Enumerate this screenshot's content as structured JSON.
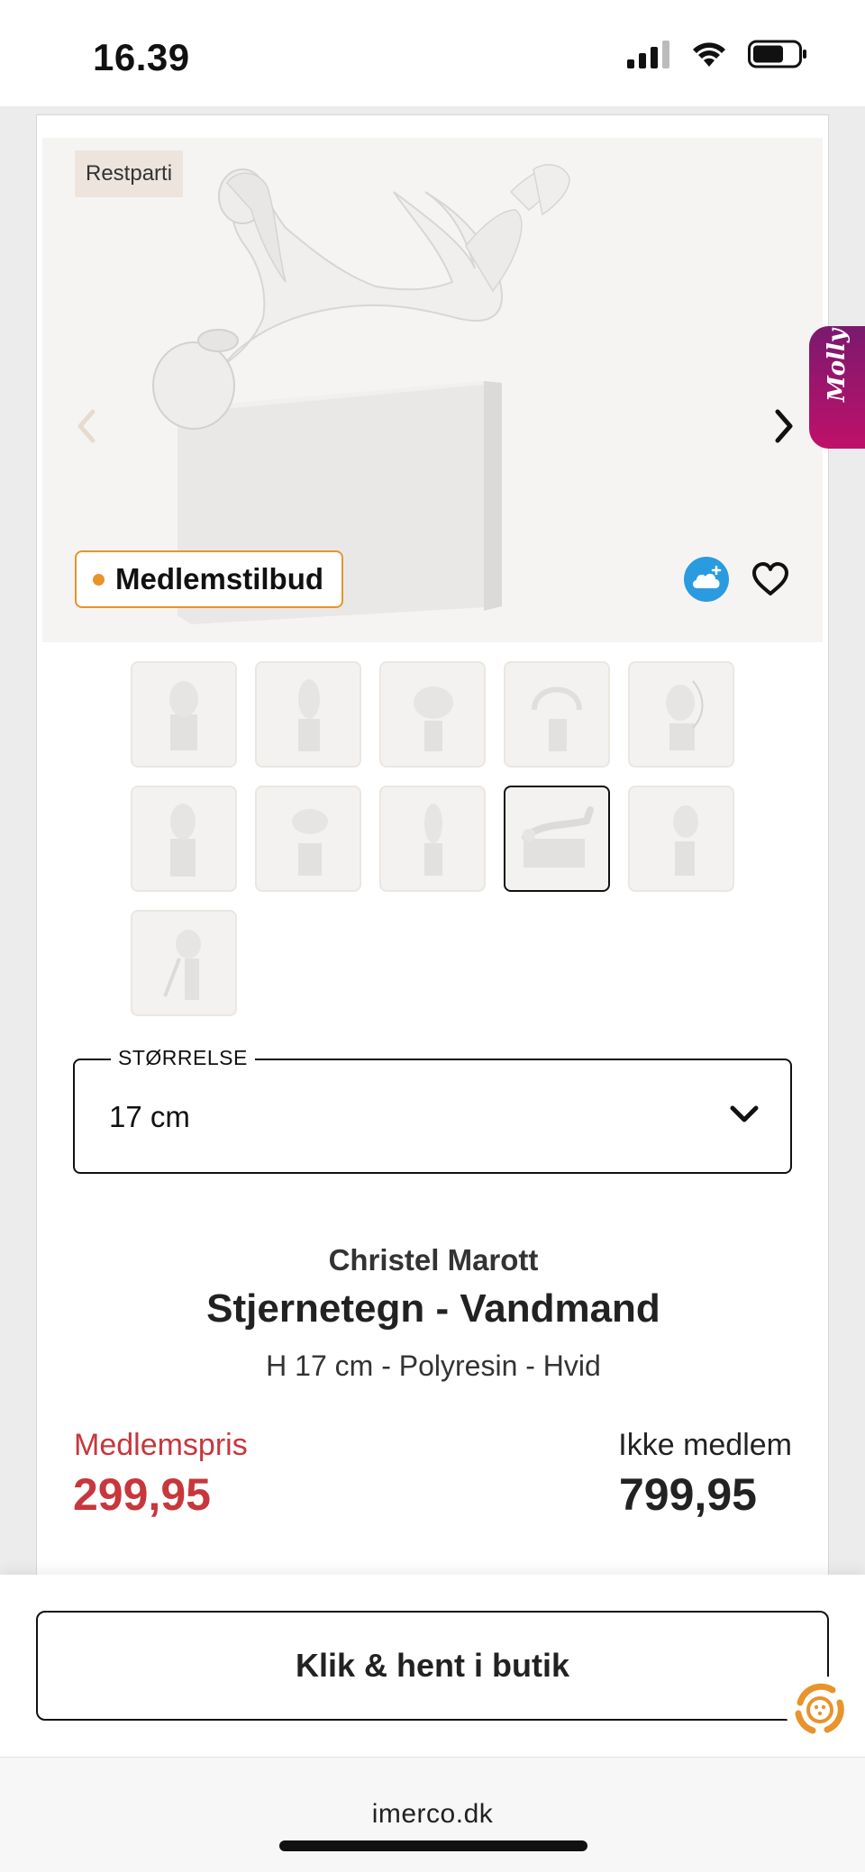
{
  "status_bar": {
    "time": "16.39"
  },
  "product_image": {
    "badge": "Restparti",
    "member_tag": "Medlemstilbud"
  },
  "thumbnails": [
    {
      "id": 1,
      "selected": false
    },
    {
      "id": 2,
      "selected": false
    },
    {
      "id": 3,
      "selected": false
    },
    {
      "id": 4,
      "selected": false
    },
    {
      "id": 5,
      "selected": false
    },
    {
      "id": 6,
      "selected": false
    },
    {
      "id": 7,
      "selected": false
    },
    {
      "id": 8,
      "selected": false
    },
    {
      "id": 9,
      "selected": true
    },
    {
      "id": 10,
      "selected": false
    },
    {
      "id": 11,
      "selected": false
    }
  ],
  "size_select": {
    "label": "STØRRELSE",
    "value": "17 cm"
  },
  "product": {
    "brand": "Christel Marott",
    "title": "Stjernetegn - Vandmand",
    "subtitle": "H 17 cm - Polyresin - Hvid"
  },
  "pricing": {
    "member_label": "Medlemspris",
    "member_price": "299,95",
    "nonmember_label": "Ikke medlem",
    "nonmember_price": "799,95"
  },
  "cta": {
    "label": "Klik & hent i butik"
  },
  "browser": {
    "url": "imerco.dk"
  },
  "chat": {
    "label": "Molly"
  },
  "colors": {
    "accent_orange": "#e8932b",
    "price_red": "#c7373c",
    "chat_magenta": "#c0106a",
    "cloud_blue": "#2b9be0"
  }
}
